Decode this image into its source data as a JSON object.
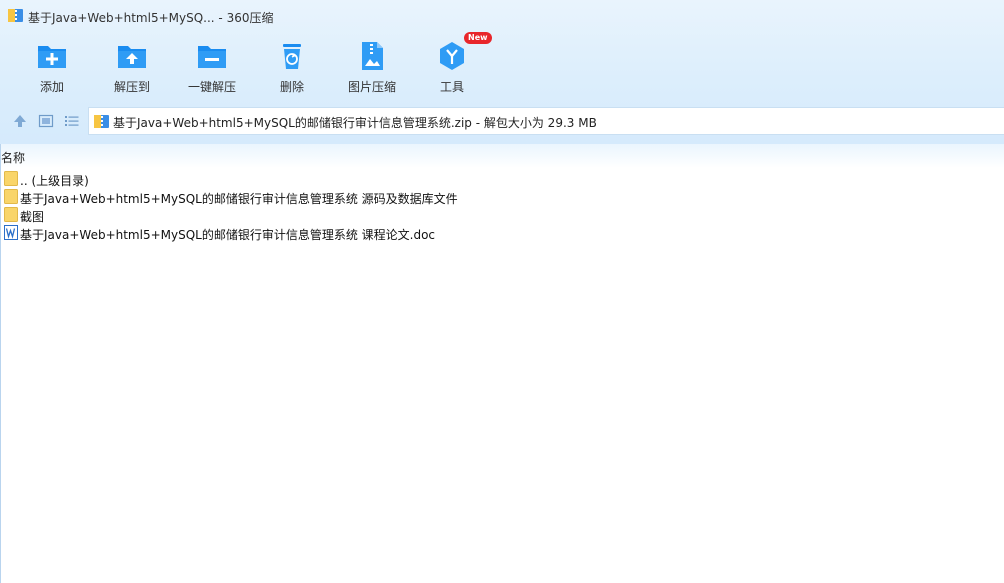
{
  "window": {
    "title": "基于Java+Web+html5+MySQ... - 360压缩"
  },
  "toolbar": {
    "buttons": [
      {
        "label": "添加",
        "icon": "add-folder-icon"
      },
      {
        "label": "解压到",
        "icon": "extract-to-icon"
      },
      {
        "label": "一键解压",
        "icon": "one-click-extract-icon"
      },
      {
        "label": "删除",
        "icon": "delete-icon"
      },
      {
        "label": "图片压缩",
        "icon": "image-compress-icon"
      },
      {
        "label": "工具",
        "icon": "tools-icon",
        "badge": "New"
      }
    ]
  },
  "address": {
    "path": "基于Java+Web+html5+MySQL的邮储银行审计信息管理系统.zip - 解包大小为 29.3 MB"
  },
  "list": {
    "column_name": "名称",
    "items": [
      {
        "name": ".. (上级目录)",
        "type": "folder"
      },
      {
        "name": "基于Java+Web+html5+MySQL的邮储银行审计信息管理系统 源码及数据库文件",
        "type": "folder"
      },
      {
        "name": "截图",
        "type": "folder"
      },
      {
        "name": "基于Java+Web+html5+MySQL的邮储银行审计信息管理系统 课程论文.doc",
        "type": "word-doc"
      }
    ]
  },
  "colors": {
    "accent": "#1a8cf0",
    "badge": "#e8262b",
    "folder": "#f9d56a"
  }
}
